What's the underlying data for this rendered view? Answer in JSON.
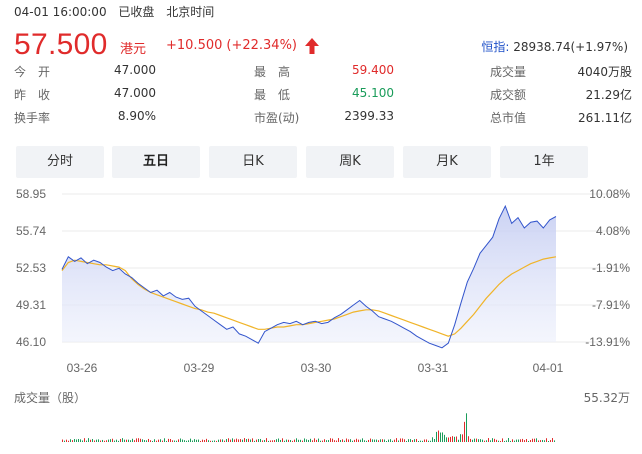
{
  "status": {
    "datetime": "04-01 16:00:00",
    "state": "已收盘",
    "timezone": "北京时间"
  },
  "quote": {
    "price": "57.500",
    "currency": "港元",
    "change": "+10.500",
    "change_pct": "(+22.34%)",
    "direction": "up",
    "color_up": "#e02b2b"
  },
  "index": {
    "name": "恒指:",
    "value": "28938.74(+1.97%)"
  },
  "stats": {
    "open": {
      "label": "今开",
      "value": "47.000"
    },
    "prev_close": {
      "label": "昨收",
      "value": "47.000"
    },
    "turnover_rate": {
      "label": "换手率",
      "value": "8.90%"
    },
    "high": {
      "label": "最高",
      "value": "59.400"
    },
    "low": {
      "label": "最低",
      "value": "45.100"
    },
    "pe": {
      "label": "市盈(动)",
      "value": "2399.33"
    },
    "volume": {
      "label": "成交量",
      "value": "4040万股"
    },
    "amount": {
      "label": "成交额",
      "value": "21.29亿"
    },
    "market_cap": {
      "label": "总市值",
      "value": "261.11亿"
    }
  },
  "tabs": [
    {
      "label": "分时"
    },
    {
      "label": "五日"
    },
    {
      "label": "日K"
    },
    {
      "label": "周K"
    },
    {
      "label": "月K"
    },
    {
      "label": "1年"
    }
  ],
  "active_tab": "五日",
  "volume_panel": {
    "label": "成交量（股）",
    "max": "55.32万"
  },
  "chart_data": {
    "type": "line",
    "title": "",
    "prev_close": 47.0,
    "ylim": [
      46.1,
      58.95
    ],
    "y_ticks_left": [
      "58.95",
      "55.74",
      "52.53",
      "49.31",
      "46.10"
    ],
    "y_ticks_right": [
      "10.08%",
      "4.08%",
      "-1.91%",
      "-7.91%",
      "-13.91%"
    ],
    "x_ticks": [
      "03-26",
      "03-29",
      "03-30",
      "03-31",
      "04-01"
    ],
    "series": [
      {
        "role": "price",
        "color": "#3355cc",
        "values": [
          52.4,
          53.5,
          53.1,
          53.4,
          52.9,
          53.2,
          53.0,
          52.6,
          52.3,
          52.5,
          52.0,
          51.7,
          51.2,
          50.8,
          50.4,
          50.6,
          50.1,
          50.4,
          50.0,
          49.8,
          49.9,
          49.2,
          48.8,
          48.4,
          48.0,
          47.6,
          47.2,
          47.4,
          46.8,
          46.6,
          46.3,
          46.0,
          47.0,
          47.3,
          47.6,
          47.8,
          47.7,
          47.9,
          47.6,
          47.8,
          47.9,
          47.7,
          47.8,
          48.2,
          48.5,
          48.9,
          49.3,
          49.7,
          49.2,
          48.8,
          48.3,
          48.1,
          47.9,
          47.6,
          47.3,
          47.0,
          46.6,
          46.3,
          46.0,
          45.8,
          45.6,
          46.0,
          47.6,
          49.5,
          51.3,
          52.5,
          53.8,
          54.5,
          55.2,
          56.8,
          57.9,
          56.4,
          56.9,
          56.0,
          56.5,
          56.6,
          56.0,
          56.7,
          57.0
        ]
      },
      {
        "role": "average",
        "color": "#f0b429",
        "values": [
          52.3,
          53.0,
          53.2,
          53.1,
          53.0,
          52.9,
          52.8,
          52.8,
          52.7,
          52.6,
          52.3,
          51.6,
          51.1,
          50.7,
          50.4,
          50.2,
          50.0,
          49.8,
          49.6,
          49.4,
          49.2,
          49.0,
          48.9,
          48.7,
          48.6,
          48.4,
          48.2,
          48.0,
          47.8,
          47.6,
          47.4,
          47.2,
          47.2,
          47.3,
          47.4,
          47.4,
          47.5,
          47.6,
          47.6,
          47.7,
          47.8,
          47.9,
          48.0,
          48.1,
          48.3,
          48.5,
          48.7,
          48.8,
          48.9,
          48.9,
          48.8,
          48.6,
          48.4,
          48.2,
          48.0,
          47.8,
          47.6,
          47.4,
          47.2,
          47.0,
          46.8,
          46.6,
          46.8,
          47.3,
          47.9,
          48.5,
          49.2,
          49.9,
          50.5,
          51.1,
          51.6,
          52.0,
          52.3,
          52.6,
          52.9,
          53.1,
          53.3,
          53.4,
          53.5
        ]
      }
    ]
  }
}
